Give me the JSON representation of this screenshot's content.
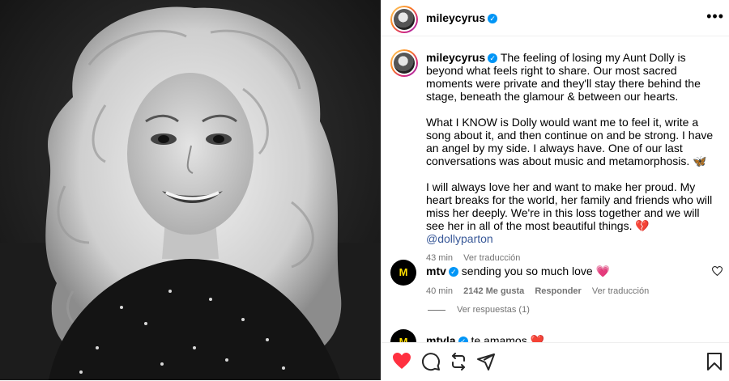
{
  "post": {
    "username": "mileycyrus",
    "verified_mark": "✓",
    "more_label": "•••",
    "caption_paragraphs": [
      "The feeling of losing my Aunt Dolly is beyond what feels right to share. Our most sacred moments were private and they'll stay there behind the stage, beneath the glamour & between our hearts.",
      "What I KNOW is Dolly would want me to feel it, write a song about it, and then continue on and be strong. I have an angel by my side. I always have. One of our last conversations was about music and metamorphosis. 🦋",
      "I will always love her and want to make her proud. My heart breaks for the world, her family and friends who will miss her deeply. We're in this loss together and we will see her in all of the most beautiful things. 💔 "
    ],
    "mention": "@dollyparton",
    "time": "43 min",
    "translate_label": "Ver traducción"
  },
  "comments": [
    {
      "username": "mtv",
      "avatar_text": "M",
      "text": "sending you so much love 💗",
      "time": "40 min",
      "likes": "2142 Me gusta",
      "reply_label": "Responder",
      "translate_label": "Ver traducción",
      "view_replies": "Ver respuestas (1)"
    },
    {
      "username": "mtvla",
      "avatar_text": "M",
      "text": "te amamos ❤️"
    }
  ],
  "icons": {
    "like": "heart-filled-icon",
    "comment": "comment-icon",
    "share": "repost-icon",
    "send": "send-icon",
    "save": "bookmark-icon"
  },
  "colors": {
    "like": "#ff3040",
    "verified": "#0095f6",
    "mention": "#385898"
  }
}
